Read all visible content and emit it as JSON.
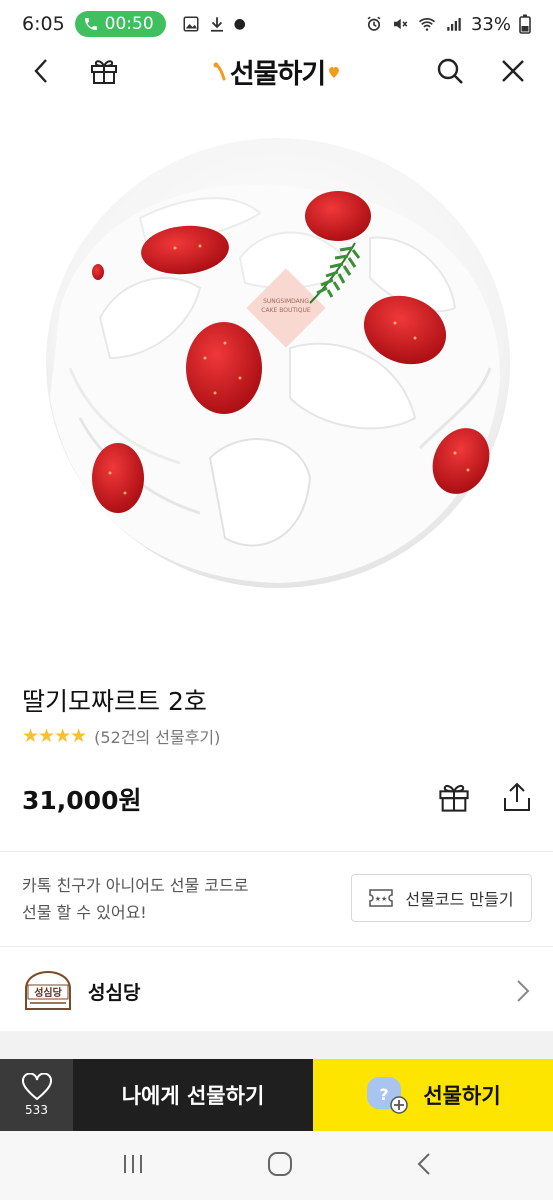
{
  "status_bar": {
    "time": "6:05",
    "call_timer": "00:50",
    "battery": "33%",
    "icons": [
      "phone-icon",
      "image-icon",
      "download-icon",
      "dot-icon",
      "alarm-icon",
      "mute-icon",
      "wifi-icon",
      "signal-icon",
      "battery-icon"
    ]
  },
  "nav": {
    "title": "선물하기",
    "left_icons": [
      "back-arrow-icon",
      "gift-box-icon"
    ],
    "right_icons": [
      "search-icon",
      "close-icon"
    ]
  },
  "product": {
    "name": "딸기모짜르트 2호",
    "stars": "★★★★",
    "rating_value": 4,
    "review_text": "(52건의 선물후기)",
    "price": "31,000원",
    "image_sign_lines": [
      "SUNGSIMDANG",
      "CAKE BOUTIQUE"
    ]
  },
  "gift_code": {
    "line1": "카톡 친구가 아니어도 선물 코드로",
    "line2": "선물 할 수 있어요!",
    "button_label": "선물코드 만들기"
  },
  "brand": {
    "name": "성심당",
    "logo_text": "성심당"
  },
  "action_bar": {
    "like_count": "533",
    "gift_to_me": "나에게 선물하기",
    "gift": "선물하기"
  },
  "colors": {
    "accent_yellow": "#fee500",
    "dark_button": "#1f1f1f",
    "like_bg": "#3a3a3a",
    "star": "#fbc02d",
    "call_pill": "#3fbf5e"
  }
}
